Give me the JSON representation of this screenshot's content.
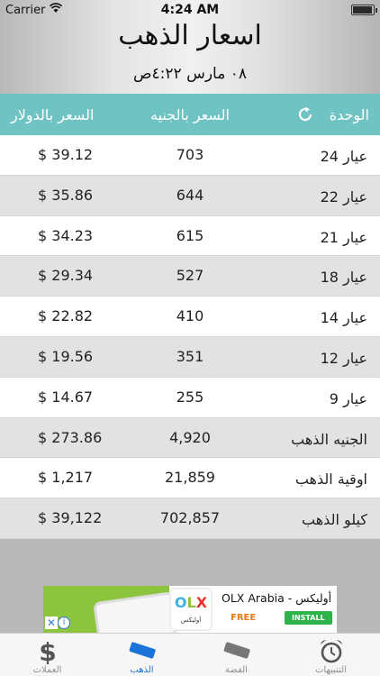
{
  "status_bar": {
    "carrier": "Carrier",
    "time": "4:24 AM"
  },
  "header": {
    "title": "اسعار الذهب",
    "subtitle": "٠٨ مارس ٤:٢٢ص"
  },
  "table": {
    "columns": {
      "usd": "السعر بالدولار",
      "egp": "السعر بالجنيه",
      "unit": "الوحدة"
    },
    "rows": [
      {
        "unit": "عيار 24",
        "egp": "703",
        "usd": "$ 39.12"
      },
      {
        "unit": "عيار 22",
        "egp": "644",
        "usd": "$ 35.86"
      },
      {
        "unit": "عيار 21",
        "egp": "615",
        "usd": "$ 34.23"
      },
      {
        "unit": "عيار 18",
        "egp": "527",
        "usd": "$ 29.34"
      },
      {
        "unit": "عيار 14",
        "egp": "410",
        "usd": "$ 22.82"
      },
      {
        "unit": "عيار 12",
        "egp": "351",
        "usd": "$ 19.56"
      },
      {
        "unit": "عيار 9",
        "egp": "255",
        "usd": "$ 14.67"
      },
      {
        "unit": "الجنيه الذهب",
        "egp": "4,920",
        "usd": "$ 273.86"
      },
      {
        "unit": "اوقية الذهب",
        "egp": "21,859",
        "usd": "$ 1,217"
      },
      {
        "unit": "كيلو الذهب",
        "egp": "702,857",
        "usd": "$ 39,122"
      }
    ]
  },
  "ad": {
    "app_name": "OLX Arabia - أوليكس",
    "logo_text": "OLX",
    "logo_sub": "أوليكس",
    "price": "FREE",
    "install_label": "INSTALL"
  },
  "tabs": [
    {
      "label": "العملات",
      "icon": "dollar-icon"
    },
    {
      "label": "الذهب",
      "icon": "gold-bar-icon",
      "active": true
    },
    {
      "label": "الفضة",
      "icon": "silver-bar-icon"
    },
    {
      "label": "التنبيهات",
      "icon": "alarm-clock-icon"
    }
  ],
  "colors": {
    "table_header": "#6fc3c3",
    "active_tab": "#1a73d9",
    "alt_row": "#e2e2e2"
  }
}
